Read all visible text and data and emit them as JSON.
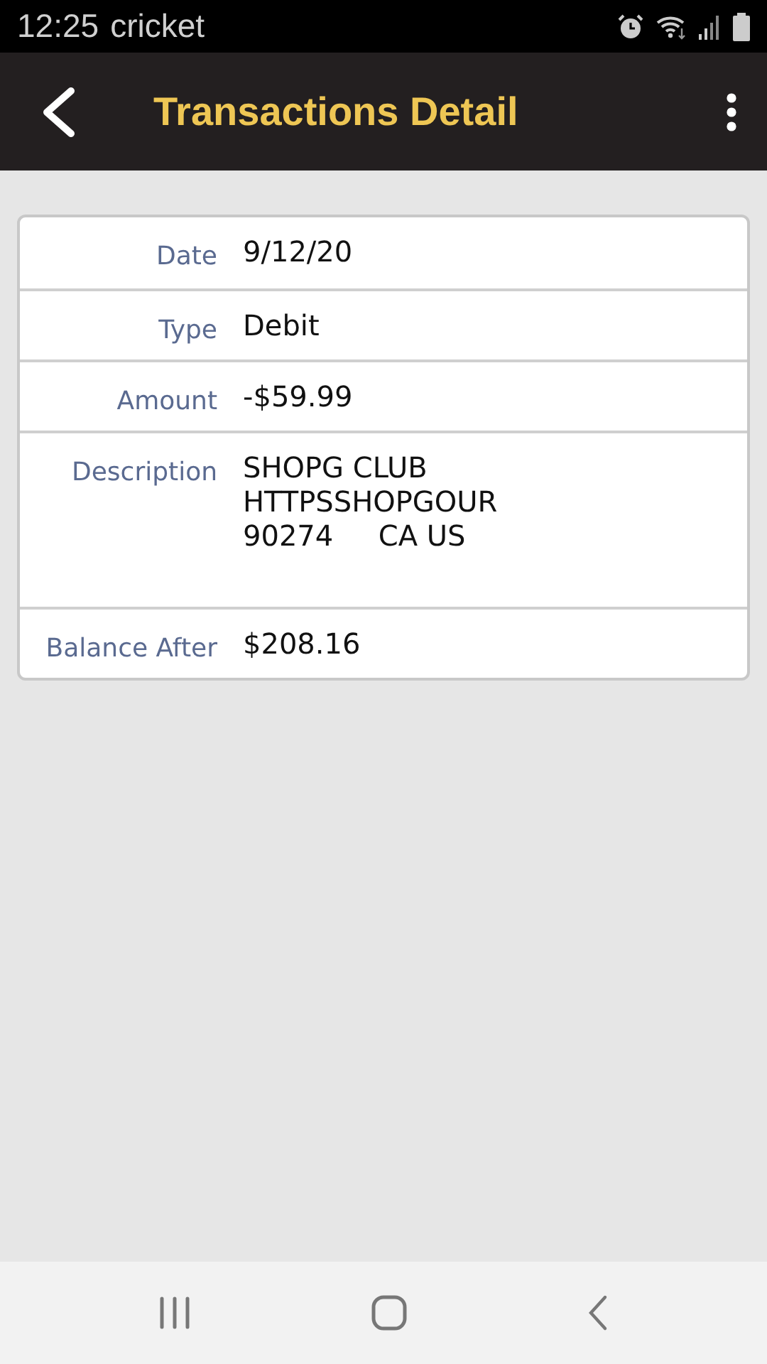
{
  "status_bar": {
    "time": "12:25",
    "carrier": "cricket"
  },
  "app_bar": {
    "title": "Transactions Detail"
  },
  "details": [
    {
      "label": "Date",
      "value": "9/12/20"
    },
    {
      "label": "Type",
      "value": "Debit"
    },
    {
      "label": "Amount",
      "value": "-$59.99"
    },
    {
      "label": "Description",
      "lines": [
        "SHOPG CLUB",
        "HTTPSSHOPGOUR",
        "90274     CA US"
      ]
    },
    {
      "label": "Balance After",
      "value": "$208.16"
    }
  ]
}
